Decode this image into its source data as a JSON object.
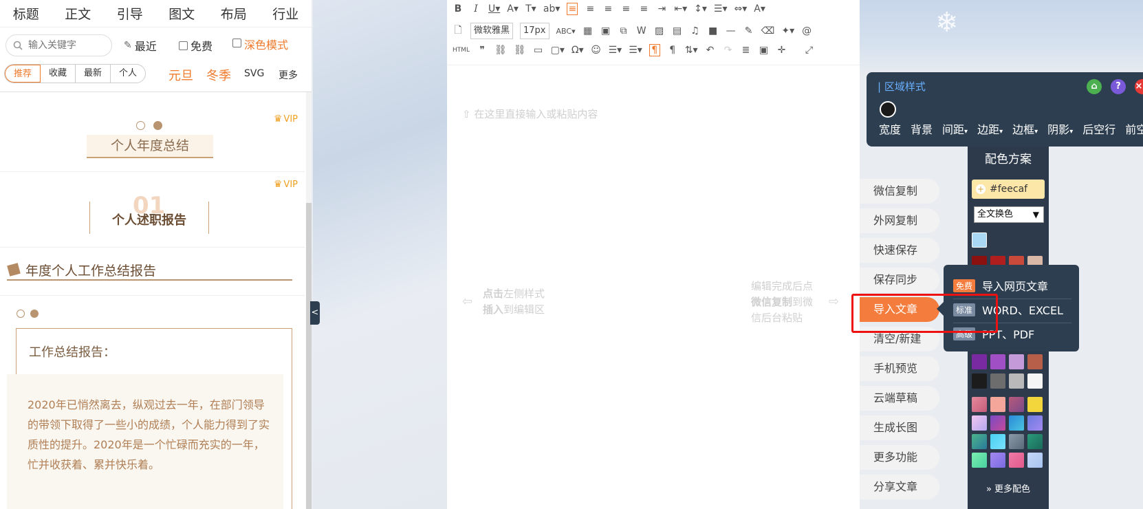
{
  "left_panel": {
    "category_tabs": [
      "标题",
      "正文",
      "引导",
      "图文",
      "布局",
      "行业"
    ],
    "search": {
      "placeholder": "输入关键字"
    },
    "options": {
      "recent": "最近",
      "free": "免费",
      "dark_mode": "深色模式"
    },
    "sub_tabs": [
      "推荐",
      "收藏",
      "最新",
      "个人"
    ],
    "seasons": [
      "元旦",
      "冬季"
    ],
    "svg_label": "SVG",
    "more_label": "更多",
    "collapse_glyph": "<",
    "templates": {
      "vip_label": "VIP",
      "t1_title": "个人年度总结",
      "t2_bg_number": "01",
      "t2_title": "个人述职报告",
      "t3_title": "年度个人工作总结报告",
      "t4_heading": "工作总结报告：",
      "t4_body": "2020年已悄然离去，纵观过去一年，在部门领导的带领下取得了一些小的成绩，个人能力得到了实质性的提升。2020年是一个忙碌而充实的一年，忙并收获着、累并快乐着。"
    }
  },
  "editor": {
    "font_family": "微软雅黑",
    "font_size": "17px",
    "placeholder": "在这里直接输入或粘贴内容",
    "hint_left": {
      "bold": "点击",
      "rest1": "左侧样式",
      "line2_bold": "插入",
      "rest2": "到编辑区"
    },
    "hint_right": {
      "line1": "编辑完成后点",
      "line2_bold": "微信复制",
      "line2_rest": "到微",
      "line3": "信后台粘贴"
    }
  },
  "actions": [
    "微信复制",
    "外网复制",
    "快速保存",
    "保存同步",
    "导入文章",
    "清空/新建",
    "手机预览",
    "云端草稿",
    "生成长图",
    "更多功能",
    "分享文章"
  ],
  "import_menu": [
    {
      "tag": "免费",
      "tag_color": "#f47c3c",
      "label": "导入网页文章"
    },
    {
      "tag": "标准",
      "tag_color": "#7a8aa0",
      "label": "WORD、EXCEL"
    },
    {
      "tag": "高级",
      "tag_color": "#7a8aa0",
      "label": "PPT、PDF"
    }
  ],
  "region_style": {
    "title": "区域样式",
    "props": [
      "宽度",
      "背景",
      "间距",
      "边距",
      "边框",
      "阴影",
      "后空行",
      "前空行"
    ]
  },
  "color_scheme": {
    "title": "配色方案",
    "input_value": "#feecaf",
    "select_value": "全文换色",
    "more_label": "更多配色",
    "accent": "#f47c3c"
  }
}
